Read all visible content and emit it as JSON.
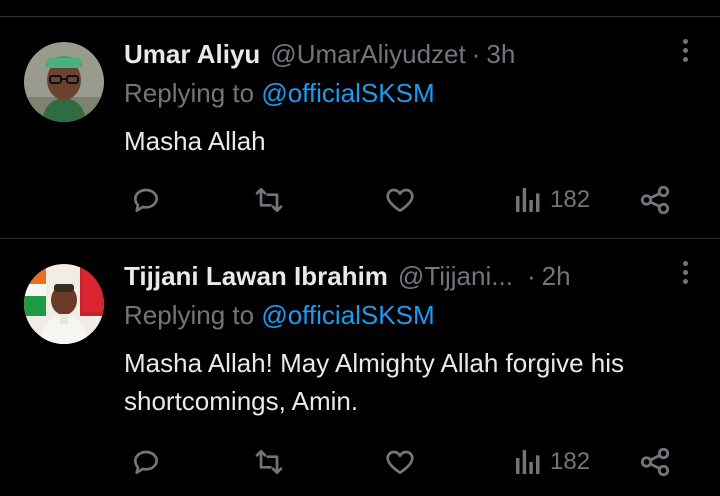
{
  "tweets": [
    {
      "name": "Umar Aliyu",
      "handle": "@UmarAliyudzet",
      "separator": "·",
      "time": "3h",
      "replying_prefix": "Replying to",
      "replying_to": "@officialSKSM",
      "text": "Masha Allah",
      "views": "182"
    },
    {
      "name": "Tijjani Lawan Ibrahim",
      "handle": "@Tijjani...",
      "separator": "·",
      "time": "2h",
      "replying_prefix": "Replying to",
      "replying_to": "@officialSKSM",
      "text": "Masha Allah! May Almighty Allah forgive his shortcomings, Amin.",
      "views": "182"
    }
  ],
  "colors": {
    "background": "#000000",
    "primary_text": "#e7e9ea",
    "secondary_text": "#71767b",
    "mention": "#1d9bf0",
    "divider": "#2f3336"
  },
  "icons": [
    "reply-icon",
    "retweet-icon",
    "like-icon",
    "views-icon",
    "share-icon",
    "more-icon"
  ]
}
